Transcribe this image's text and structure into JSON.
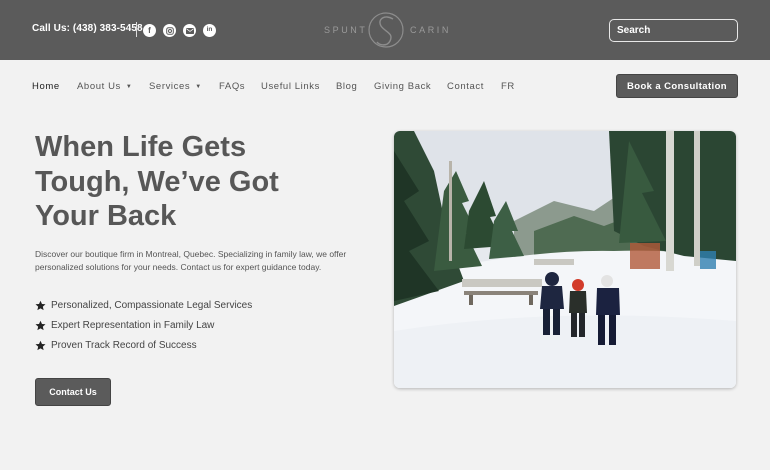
{
  "header": {
    "phone": "Call Us: (438) 383-5458",
    "social_icons": [
      "facebook-icon",
      "instagram-icon",
      "email-icon",
      "linkedin-icon"
    ],
    "logo_left": "SPUNT",
    "logo_right": "CARIN",
    "search_placeholder": "Search"
  },
  "nav": {
    "items": [
      {
        "label": "Home"
      },
      {
        "label": "About Us"
      },
      {
        "label": "Services"
      },
      {
        "label": "FAQs"
      },
      {
        "label": "Useful Links"
      },
      {
        "label": "Blog"
      },
      {
        "label": "Giving Back"
      },
      {
        "label": "Contact"
      },
      {
        "label": "FR"
      }
    ],
    "cta_label": "Book a Consultation"
  },
  "hero": {
    "title_lines": [
      "When Life Gets",
      "Tough, We’ve Got",
      "Your Back"
    ],
    "description": "Discover our boutique firm in Montreal, Quebec. Specializing in family law, we offer personalized solutions for your needs. Contact us for expert guidance today.",
    "features": [
      "Personalized, Compassionate Legal Services",
      "Expert Representation in Family Law",
      "Proven Track Record of Success"
    ],
    "button_label": "Contact Us"
  },
  "colors": {
    "topbar": "#5b5b5b",
    "page_background": "#f2f2f2",
    "button": "#5b5b5b"
  }
}
